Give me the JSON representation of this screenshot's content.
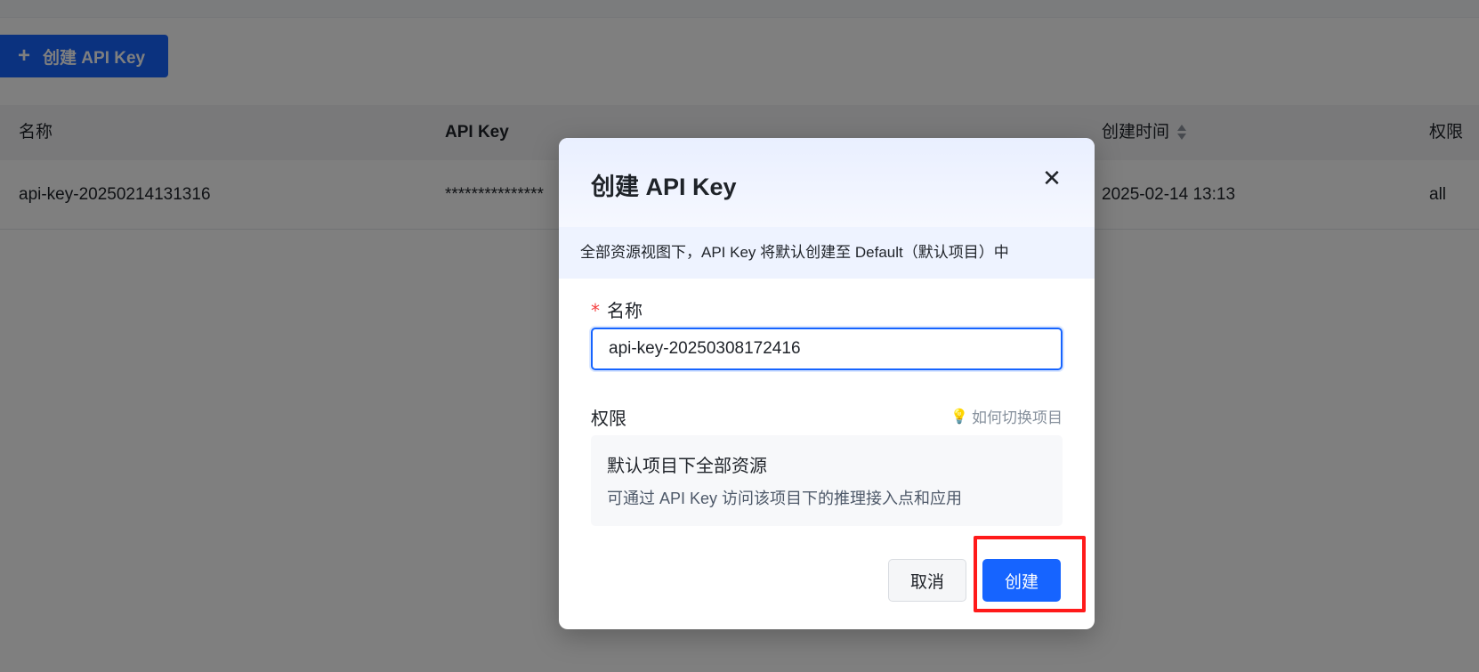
{
  "toolbar": {
    "create_button_label": "创建 API Key",
    "create_button_icon": "plus-icon"
  },
  "table": {
    "columns": [
      "名称",
      "API Key",
      "创建时间",
      "权限"
    ],
    "rows": [
      {
        "name": "api-key-20250214131316",
        "api_key": "***************",
        "created_at": "2025-02-14 13:13",
        "permission": "all"
      }
    ]
  },
  "modal": {
    "title": "创建 API Key",
    "close_icon": "close-icon",
    "notice": "全部资源视图下，API Key 将默认创建至 Default（默认项目）中",
    "name_field": {
      "label": "名称",
      "required_mark": "*",
      "value": "api-key-20250308172416"
    },
    "permission": {
      "label": "权限",
      "help_link": "如何切换项目",
      "help_icon": "💡",
      "option_title": "默认项目下全部资源",
      "option_desc": "可通过 API Key 访问该项目下的推理接入点和应用"
    },
    "cancel_label": "取消",
    "create_label": "创建"
  },
  "colors": {
    "primary": "#1664ff",
    "highlight": "#ff1a1a",
    "required": "#f53f3f"
  }
}
